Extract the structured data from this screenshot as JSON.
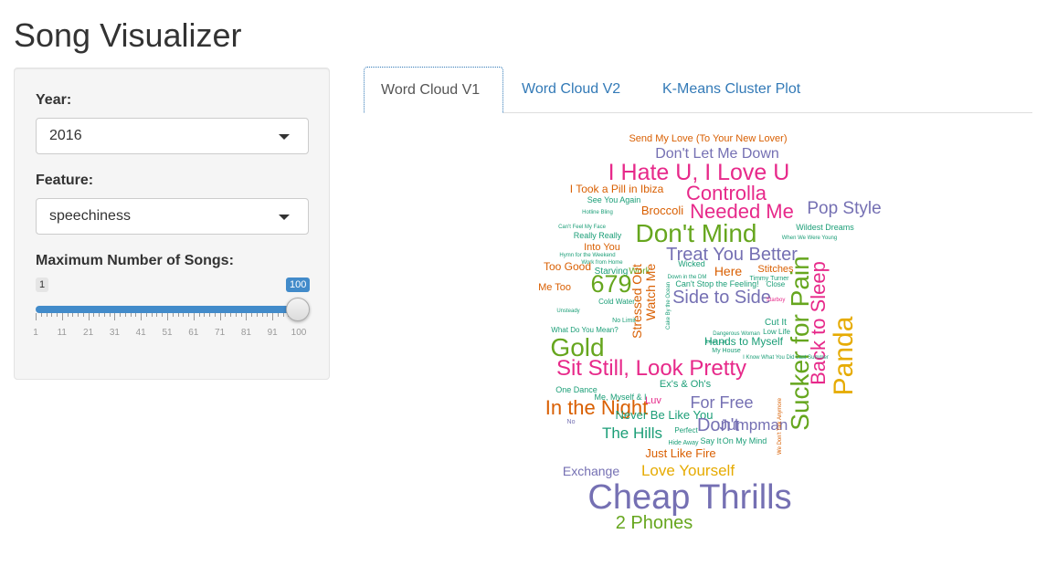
{
  "app": {
    "title": "Song Visualizer"
  },
  "controls": {
    "year_label": "Year:",
    "year_value": "2016",
    "feature_label": "Feature:",
    "feature_value": "speechiness",
    "max_songs_label": "Maximum Number of Songs:",
    "slider": {
      "min": 1,
      "max": 100,
      "value": 100,
      "min_label": "1",
      "value_label": "100",
      "tick_labels": [
        "1",
        "11",
        "21",
        "31",
        "41",
        "51",
        "61",
        "71",
        "81",
        "91",
        "100"
      ]
    }
  },
  "tabs": [
    {
      "label": "Word Cloud V1",
      "active": true
    },
    {
      "label": "Word Cloud V2",
      "active": false
    },
    {
      "label": "K-Means Cluster Plot",
      "active": false
    }
  ],
  "colors": {
    "accent": "#428bca",
    "link": "#337ab7",
    "green": "#66a61e",
    "orange": "#d95f02",
    "purple": "#7570b3",
    "pink": "#e7298a",
    "gold": "#e6ab02",
    "teal": "#1b9e77"
  },
  "word_cloud": {
    "words": [
      {
        "text": "Send My Love (To Your New Lover)",
        "color": "#d95f02"
      },
      {
        "text": "Don't Let Me Down",
        "color": "#7570b3"
      },
      {
        "text": "I Hate U, I Love U",
        "color": "#e7298a"
      },
      {
        "text": "I Took a Pill in Ibiza",
        "color": "#d95f02"
      },
      {
        "text": "Controlla",
        "color": "#e7298a"
      },
      {
        "text": "See You Again",
        "color": "#1b9e77"
      },
      {
        "text": "Hotline Bling",
        "color": "#1b9e77"
      },
      {
        "text": "Broccoli",
        "color": "#d95f02"
      },
      {
        "text": "Needed Me",
        "color": "#e7298a"
      },
      {
        "text": "Pop Style",
        "color": "#7570b3"
      },
      {
        "text": "Can't Feel My Face",
        "color": "#1b9e77"
      },
      {
        "text": "Don't Mind",
        "color": "#66a61e"
      },
      {
        "text": "Wildest Dreams",
        "color": "#1b9e77"
      },
      {
        "text": "Really Really",
        "color": "#1b9e77"
      },
      {
        "text": "When We Were Young",
        "color": "#1b9e77"
      },
      {
        "text": "Into You",
        "color": "#d95f02"
      },
      {
        "text": "Hymn for the Weekend",
        "color": "#1b9e77"
      },
      {
        "text": "Treat You Better",
        "color": "#7570b3"
      },
      {
        "text": "Work from Home",
        "color": "#1b9e77"
      },
      {
        "text": "Too Good",
        "color": "#d95f02"
      },
      {
        "text": "Starving",
        "color": "#1b9e77"
      },
      {
        "text": "Work",
        "color": "#66a61e"
      },
      {
        "text": "Wicked",
        "color": "#1b9e77"
      },
      {
        "text": "Here",
        "color": "#d95f02"
      },
      {
        "text": "Stitches",
        "color": "#d95f02"
      },
      {
        "text": "Down in the DM",
        "color": "#1b9e77"
      },
      {
        "text": "Timmy Turner",
        "color": "#1b9e77"
      },
      {
        "text": "Can't Stop the Feeling!",
        "color": "#1b9e77"
      },
      {
        "text": "Close",
        "color": "#1b9e77"
      },
      {
        "text": "Me Too",
        "color": "#d95f02"
      },
      {
        "text": "679",
        "color": "#66a61e"
      },
      {
        "text": "Watch Me",
        "color": "#d95f02"
      },
      {
        "text": "Stressed Out",
        "color": "#d95f02"
      },
      {
        "text": "Side to Side",
        "color": "#7570b3"
      },
      {
        "text": "Sucker for Pain",
        "color": "#66a61e"
      },
      {
        "text": "Back to Sleep",
        "color": "#e7298a"
      },
      {
        "text": "Panda",
        "color": "#e6ab02"
      },
      {
        "text": "Cold Water",
        "color": "#1b9e77"
      },
      {
        "text": "Cake By the Ocean",
        "color": "#1b9e77"
      },
      {
        "text": "Starboy",
        "color": "#e7298a"
      },
      {
        "text": "Cut It",
        "color": "#1b9e77"
      },
      {
        "text": "Unsteady",
        "color": "#1b9e77"
      },
      {
        "text": "No Limit",
        "color": "#1b9e77"
      },
      {
        "text": "Low Life",
        "color": "#1b9e77"
      },
      {
        "text": "What Do You Mean?",
        "color": "#1b9e77"
      },
      {
        "text": "Dangerous Woman",
        "color": "#1b9e77"
      },
      {
        "text": "Gold",
        "color": "#66a61e"
      },
      {
        "text": "Lean On",
        "color": "#1b9e77"
      },
      {
        "text": "Hands to Myself",
        "color": "#1b9e77"
      },
      {
        "text": "Sit Still, Look Pretty",
        "color": "#e7298a"
      },
      {
        "text": "My House",
        "color": "#1b9e77"
      },
      {
        "text": "I Know What You Did Last Summer",
        "color": "#1b9e77"
      },
      {
        "text": "Ex's & Oh's",
        "color": "#1b9e77"
      },
      {
        "text": "One Dance",
        "color": "#1b9e77"
      },
      {
        "text": "Me, Myself & I",
        "color": "#1b9e77"
      },
      {
        "text": "For Free",
        "color": "#7570b3"
      },
      {
        "text": "Luv",
        "color": "#e7298a"
      },
      {
        "text": "In the Night",
        "color": "#d95f02"
      },
      {
        "text": "Never Be Like You",
        "color": "#1b9e77"
      },
      {
        "text": "No",
        "color": "#7570b3"
      },
      {
        "text": "Don't",
        "color": "#7570b3"
      },
      {
        "text": "Jumpman",
        "color": "#7570b3"
      },
      {
        "text": "The Hills",
        "color": "#1b9e77"
      },
      {
        "text": "Perfect",
        "color": "#1b9e77"
      },
      {
        "text": "Hide Away",
        "color": "#1b9e77"
      },
      {
        "text": "Say It",
        "color": "#1b9e77"
      },
      {
        "text": "On My Mind",
        "color": "#1b9e77"
      },
      {
        "text": "We Don't Talk Anymore",
        "color": "#d95f02"
      },
      {
        "text": "Just Like Fire",
        "color": "#d95f02"
      },
      {
        "text": "Exchange",
        "color": "#7570b3"
      },
      {
        "text": "Love Yourself",
        "color": "#e6ab02"
      },
      {
        "text": "Cheap Thrills",
        "color": "#7570b3"
      },
      {
        "text": "2 Phones",
        "color": "#66a61e"
      }
    ]
  }
}
